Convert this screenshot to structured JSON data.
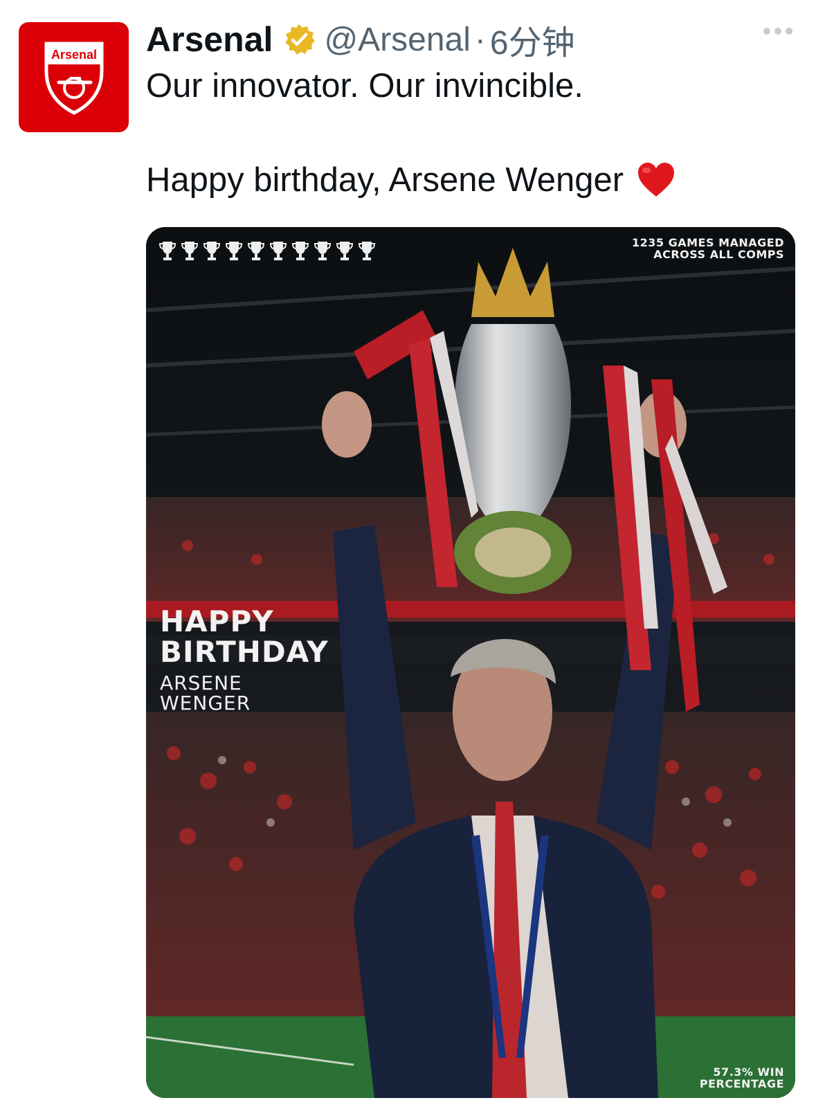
{
  "account": {
    "display_name": "Arsenal",
    "handle": "@Arsenal",
    "separator": "·",
    "timestamp": "6分钟",
    "avatar_text": "Arsenal",
    "verified_color": "#e8b923",
    "brand_color": "#db0007"
  },
  "tweet": {
    "line1": "Our innovator. Our invincible.",
    "line2": "Happy birthday, Arsene Wenger"
  },
  "media": {
    "stat_top_line1": "1235 GAMES MANAGED",
    "stat_top_line2": "ACROSS ALL COMPS",
    "happy": "HAPPY",
    "birthday": "BIRTHDAY",
    "first_name": "ARSENE",
    "last_name": "WENGER",
    "stat_bottom_line1": "57.3% WIN",
    "stat_bottom_line2": "PERCENTAGE",
    "trophy_count": 10
  },
  "icons": [
    "verified-badge-icon",
    "more-icon",
    "heart-emoji-icon",
    "trophy-icon"
  ]
}
